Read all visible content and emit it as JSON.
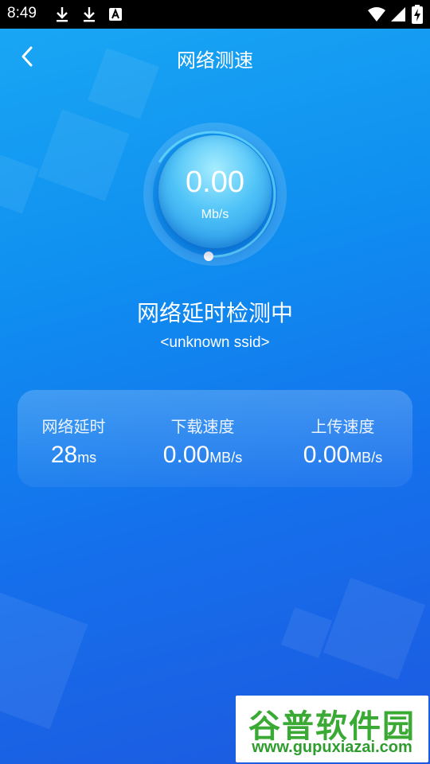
{
  "status_bar": {
    "time": "8:49",
    "left_icons": [
      "download-icon",
      "download-icon",
      "text-a-icon"
    ],
    "right_icons": [
      "wifi-icon",
      "signal-icon",
      "battery-charging-icon"
    ]
  },
  "header": {
    "title": "网络测速",
    "back_icon": "chevron-left-icon"
  },
  "gauge": {
    "value": "0.00",
    "unit": "Mb/s",
    "progress": 0
  },
  "status": {
    "message": "网络延时检测中",
    "ssid": "<unknown ssid>"
  },
  "stats": [
    {
      "label": "网络延时",
      "value": "28",
      "unit": "ms"
    },
    {
      "label": "下载速度",
      "value": "0.00",
      "unit": "MB/s"
    },
    {
      "label": "上传速度",
      "value": "0.00",
      "unit": "MB/s"
    }
  ],
  "watermark": {
    "title": "谷普软件园",
    "url": "www.gupuxiazai.com"
  },
  "colors": {
    "background_top": "#1aa9f4",
    "background_bottom": "#1d59e0",
    "watermark_green": "#3aaa35"
  }
}
